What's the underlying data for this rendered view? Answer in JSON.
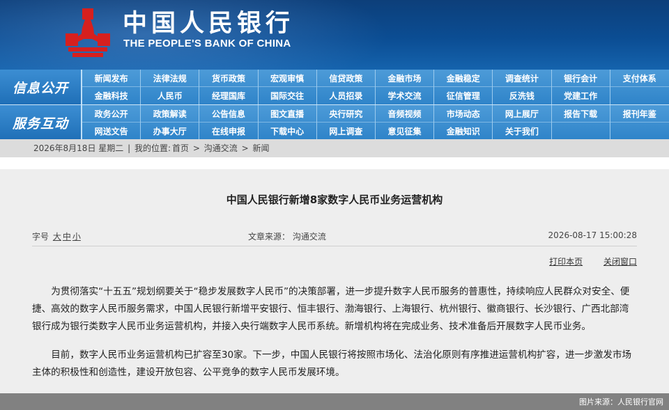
{
  "header": {
    "cn_name": "中国人民银行",
    "en_name": "THE PEOPLE'S BANK OF CHINA",
    "logo_icon": "pboc-emblem-icon",
    "logo_color": "#d6201e"
  },
  "nav": [
    {
      "label": "信息公开",
      "items": [
        "新闻发布",
        "法律法规",
        "货币政策",
        "宏观审慎",
        "信贷政策",
        "金融市场",
        "金融稳定",
        "调查统计",
        "银行会计",
        "支付体系",
        "金融科技",
        "人民币",
        "经理国库",
        "国际交往",
        "人员招录",
        "学术交流",
        "征信管理",
        "反洗钱",
        "党建工作",
        ""
      ]
    },
    {
      "label": "服务互动",
      "items": [
        "政务公开",
        "政策解读",
        "公告信息",
        "图文直播",
        "央行研究",
        "音频视频",
        "市场动态",
        "网上展厅",
        "报告下载",
        "报刊年鉴",
        "网送文告",
        "办事大厅",
        "在线申报",
        "下载中心",
        "网上调查",
        "意见征集",
        "金融知识",
        "关于我们",
        "",
        ""
      ]
    }
  ],
  "breadcrumb": {
    "date": "2026年8月18日 星期二",
    "divider": "|",
    "location_label": "我的位置:",
    "path": [
      "首页",
      "沟通交流",
      "新闻"
    ],
    "separator": ">"
  },
  "article": {
    "title": "中国人民银行新增8家数字人民币业务运营机构",
    "font_size_label": "字号",
    "font_size_options": [
      "大",
      "中",
      "小"
    ],
    "source": "文章来源： 沟通交流",
    "date": "2026-08-17 15:00:28",
    "print_label": "打印本页",
    "close_label": "关闭窗口",
    "paragraphs": [
      "为贯彻落实“十五五”规划纲要关于“稳步发展数字人民币”的决策部署，进一步提升数字人民币服务的普惠性，持续响应人民群众对安全、便捷、高效的数字人民币服务需求，中国人民银行新增平安银行、恒丰银行、渤海银行、上海银行、杭州银行、徽商银行、长沙银行、广西北部湾银行成为银行类数字人民币业务运营机构，并接入央行端数字人民币系统。新增机构将在完成业务、技术准备后开展数字人民币业务。",
      "目前，数字人民币业务运营机构已扩容至30家。下一步，中国人民银行将按照市场化、法治化原则有序推进运营机构扩容，进一步激发市场主体的积极性和创造性，建设开放包容、公平竞争的数字人民币发展环境。"
    ]
  },
  "credit": "图片来源：人民银行官网"
}
